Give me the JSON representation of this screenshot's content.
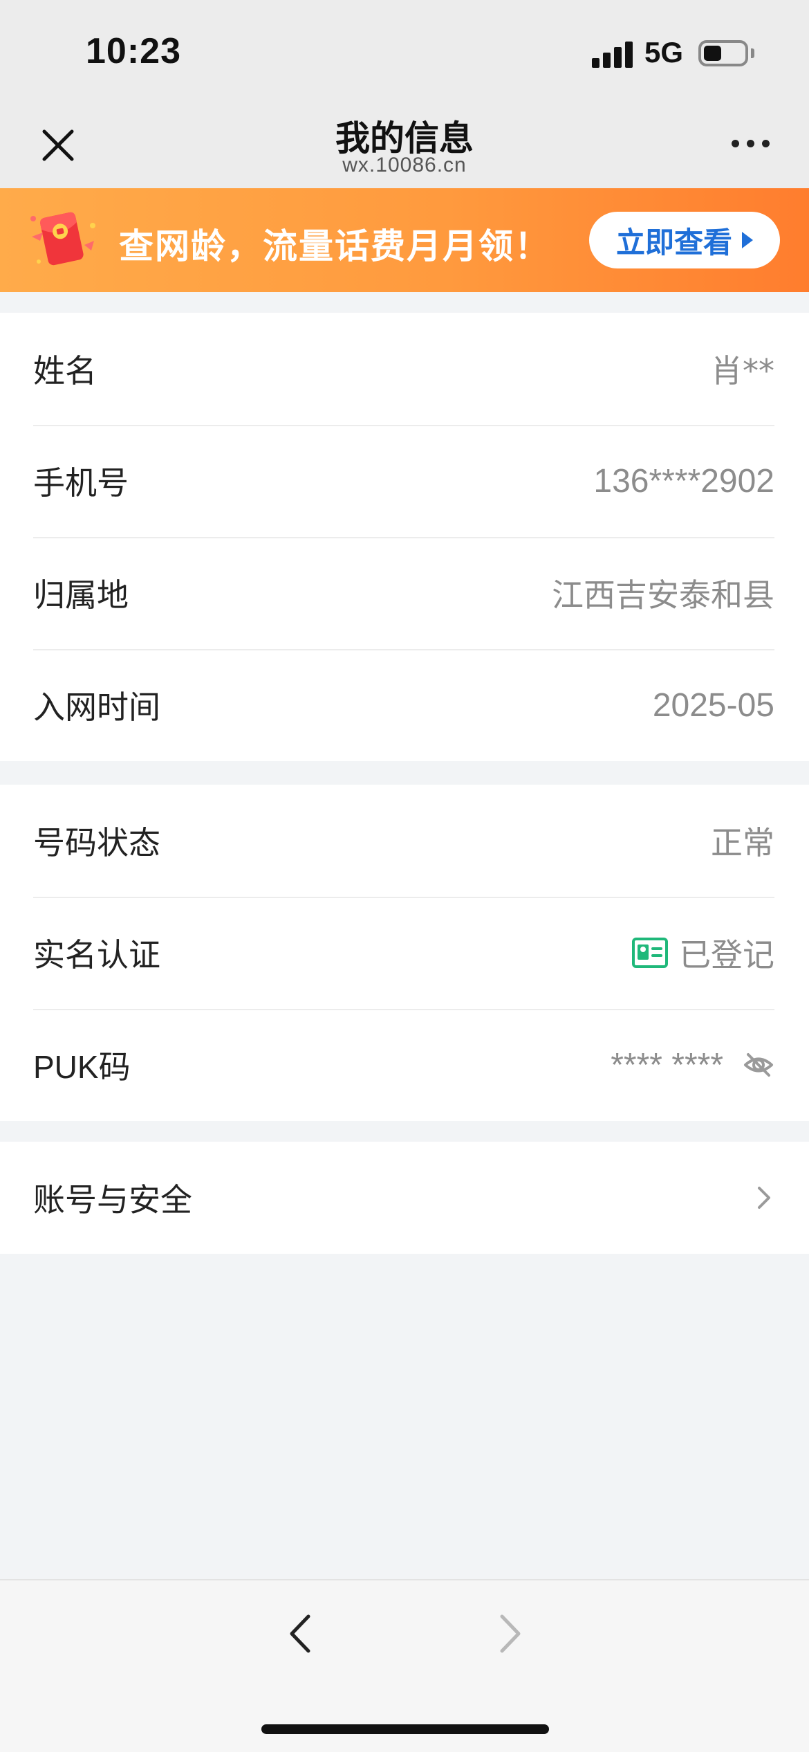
{
  "status_bar": {
    "time": "10:23",
    "network": "5G",
    "battery_level": 0.45
  },
  "nav": {
    "title": "我的信息",
    "subtitle": "wx.10086.cn",
    "close_icon": "close-icon",
    "more_icon": "more-icon"
  },
  "banner": {
    "text": "查网龄，流量话费月月领！",
    "button_label": "立即查看",
    "icon": "red-envelope-icon"
  },
  "profile_section": {
    "rows": [
      {
        "label": "姓名",
        "value": "肖**"
      },
      {
        "label": "手机号",
        "value": "136****2902"
      },
      {
        "label": "归属地",
        "value": "江西吉安泰和县"
      },
      {
        "label": "入网时间",
        "value": "2025-05"
      }
    ]
  },
  "status_section": {
    "number_status": {
      "label": "号码状态",
      "value": "正常"
    },
    "real_name": {
      "label": "实名认证",
      "value": "已登记",
      "icon": "id-card-icon"
    },
    "puk": {
      "label": "PUK码",
      "value": "**** ****",
      "icon": "eye-off-icon"
    }
  },
  "account_section": {
    "label": "账号与安全",
    "icon": "chevron-right-icon"
  },
  "bottom_bar": {
    "back_icon": "chevron-left-icon",
    "forward_icon": "chevron-right-icon"
  },
  "colors": {
    "accent_blue": "#1f6fd8",
    "banner_orange": "#ff9a3e",
    "verified_green": "#1fb87a",
    "value_gray": "#8c8c8c"
  }
}
